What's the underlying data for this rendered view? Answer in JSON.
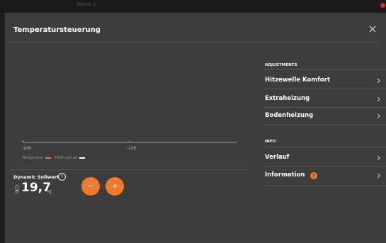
{
  "backdrop": {
    "title": "Wasser 1"
  },
  "dialog": {
    "title": "Temperatursteuerung"
  },
  "chart_data": {
    "type": "line",
    "x_ticks": [
      "-24h",
      "-12h"
    ],
    "series": [
      {
        "name": "Temperatur",
        "color": "#f07a2a",
        "values": []
      },
      {
        "name": "Fühlt sich an",
        "color": "#ffffff",
        "values": []
      }
    ],
    "grid": false,
    "legend_position": "bottom-left"
  },
  "setpoint": {
    "label": "Dynamic Sollwert",
    "help_glyph": "?",
    "value": "19,7",
    "unit": "°C",
    "minus_label": "−",
    "plus_label": "+"
  },
  "adjustments": {
    "heading": "ADJUSTMENTS",
    "items": [
      {
        "label": "Hitzewelle Komfort"
      },
      {
        "label": "Extraheizung"
      },
      {
        "label": "Bodenheizung"
      }
    ]
  },
  "info": {
    "heading": "INFO",
    "items": [
      {
        "label": "Verlauf"
      },
      {
        "label": "Information",
        "badge": "!"
      }
    ]
  },
  "colors": {
    "accent": "#f07a2a",
    "dialog_bg": "#3d3d3d",
    "backdrop_bg": "#1e1e1e"
  }
}
